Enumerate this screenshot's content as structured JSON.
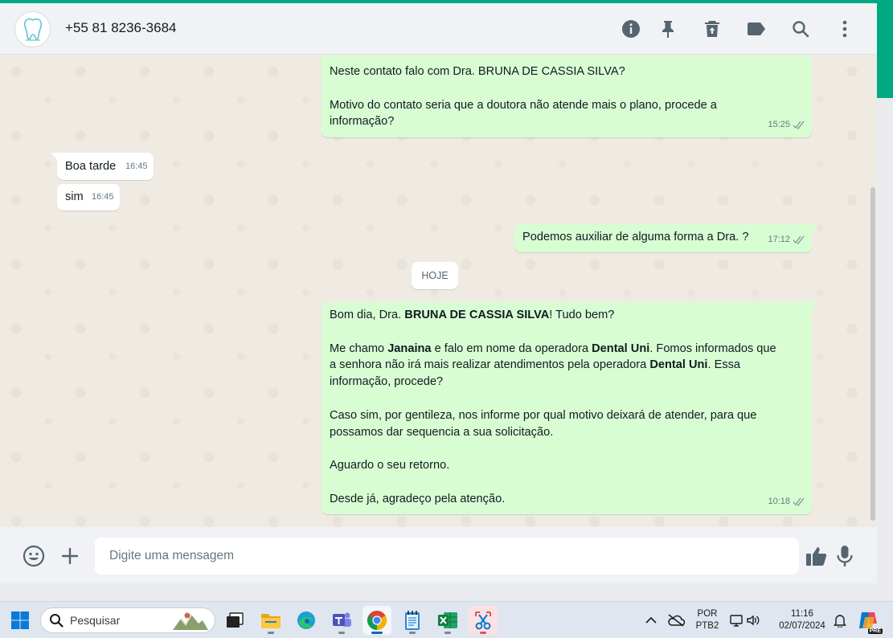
{
  "header": {
    "contact": "+55 81 8236-3684",
    "icons": [
      "info-icon",
      "pin-icon",
      "delete-icon",
      "label-icon",
      "search-icon",
      "menu-icon"
    ]
  },
  "messages": [
    {
      "direction": "out",
      "time": "15:25",
      "lines": [
        [
          {
            "t": "Neste contato falo com Dra. BRUNA DE CASSIA SILVA?"
          }
        ],
        [],
        [
          {
            "t": "Motivo do contato seria que a doutora não atende mais o plano, procede a"
          }
        ],
        [
          {
            "t": "informação?"
          }
        ]
      ]
    },
    {
      "direction": "in",
      "time": "16:45",
      "text": "Boa tarde"
    },
    {
      "direction": "in",
      "time": "16:45",
      "text": "sim"
    },
    {
      "direction": "out",
      "time": "17:12",
      "text": "Podemos auxiliar de alguma forma a Dra. ?"
    },
    {
      "date_divider": "HOJE"
    },
    {
      "direction": "out",
      "time": "10:18",
      "lines": [
        [
          {
            "t": "Bom dia, Dra. "
          },
          {
            "t": "BRUNA DE CASSIA SILVA",
            "b": true
          },
          {
            "t": "! Tudo bem?"
          }
        ],
        [],
        [
          {
            "t": "Me chamo "
          },
          {
            "t": "Janaina",
            "b": true
          },
          {
            "t": " e falo em nome da operadora "
          },
          {
            "t": "Dental Uni",
            "b": true
          },
          {
            "t": ". Fomos informados que"
          }
        ],
        [
          {
            "t": "a senhora não irá mais realizar atendimentos pela operadora "
          },
          {
            "t": "Dental Uni",
            "b": true
          },
          {
            "t": ". Essa"
          }
        ],
        [
          {
            "t": "informação, procede?"
          }
        ],
        [],
        [
          {
            "t": "Caso sim, por gentileza, nos informe por qual motivo deixará de atender, para que"
          }
        ],
        [
          {
            "t": "possamos dar sequencia a sua solicitação."
          }
        ],
        [],
        [
          {
            "t": "Aguardo o seu retorno."
          }
        ],
        [],
        [
          {
            "t": "Desde já, agradeço pela atenção."
          }
        ]
      ]
    }
  ],
  "composer": {
    "placeholder": "Digite uma mensagem",
    "icons": [
      "emoji-icon",
      "attach-plus-icon",
      "thumbs-up-icon",
      "microphone-icon"
    ]
  },
  "taskbar": {
    "search_label": "Pesquisar",
    "apps": [
      "windows-start-icon",
      "task-view-icon",
      "file-explorer-icon",
      "edge-icon",
      "teams-icon",
      "chrome-icon",
      "notepad-icon",
      "excel-icon",
      "snipping-tool-icon"
    ],
    "lang_top": "POR",
    "lang_bottom": "PTB2",
    "time": "11:16",
    "date": "02/07/2024",
    "copilot_badge": "PRE"
  },
  "colors": {
    "accent": "#00a884",
    "out_bubble": "#d9fdd3",
    "in_bubble": "#ffffff",
    "chat_bg": "#efeae2",
    "panel_bg": "#f0f2f5"
  }
}
